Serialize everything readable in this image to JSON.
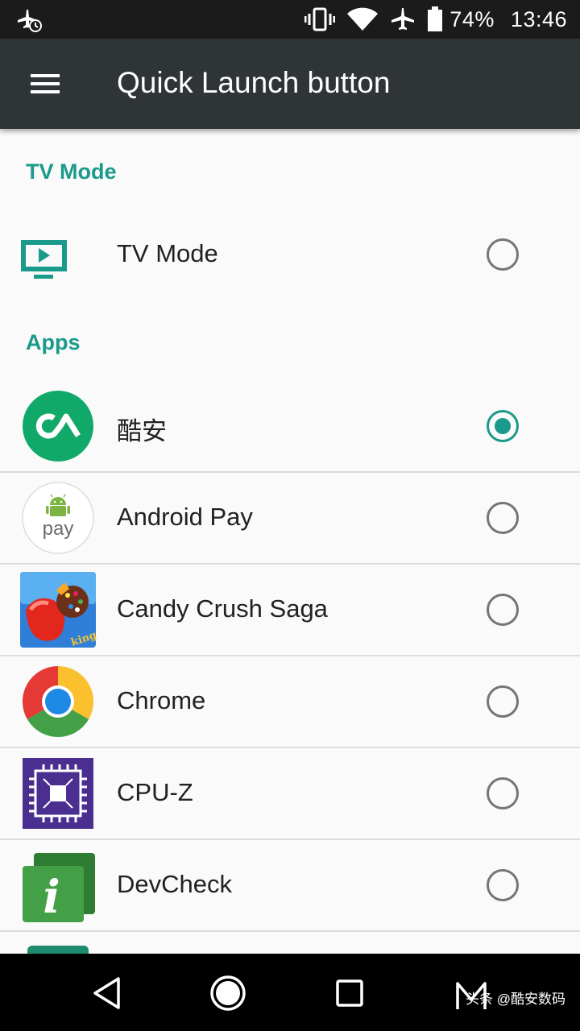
{
  "status_bar": {
    "battery_percent": "74%",
    "time": "13:46",
    "icons": [
      "airplane-clock-icon",
      "vibrate-icon",
      "wifi-icon",
      "airplane-icon",
      "battery-icon"
    ]
  },
  "toolbar": {
    "menu_icon": "hamburger-menu-icon",
    "title": "Quick Launch button"
  },
  "sections": {
    "tv_mode": {
      "header": "TV Mode",
      "item": {
        "label": "TV Mode",
        "icon": "tv-play-icon",
        "selected": false
      }
    },
    "apps": {
      "header": "Apps",
      "items": [
        {
          "label": "酷安",
          "icon": "coolapk-icon",
          "selected": true
        },
        {
          "label": "Android Pay",
          "icon": "android-pay-icon",
          "icon_text": "pay",
          "selected": false
        },
        {
          "label": "Candy Crush Saga",
          "icon": "candy-crush-icon",
          "icon_text": "king",
          "selected": false
        },
        {
          "label": "Chrome",
          "icon": "chrome-icon",
          "selected": false
        },
        {
          "label": "CPU-Z",
          "icon": "cpu-z-icon",
          "selected": false
        },
        {
          "label": "DevCheck",
          "icon": "devcheck-icon",
          "icon_text": "i",
          "selected": false
        }
      ]
    }
  },
  "nav_bar": {
    "buttons": [
      "back-icon",
      "home-icon",
      "recents-icon",
      "gesture-m-icon"
    ],
    "watermark": "头条 @酷安数码"
  },
  "colors": {
    "accent": "#1a9a8a",
    "toolbar": "#2f3437",
    "status_bar": "#1b1b1b",
    "background": "#fafafa"
  }
}
